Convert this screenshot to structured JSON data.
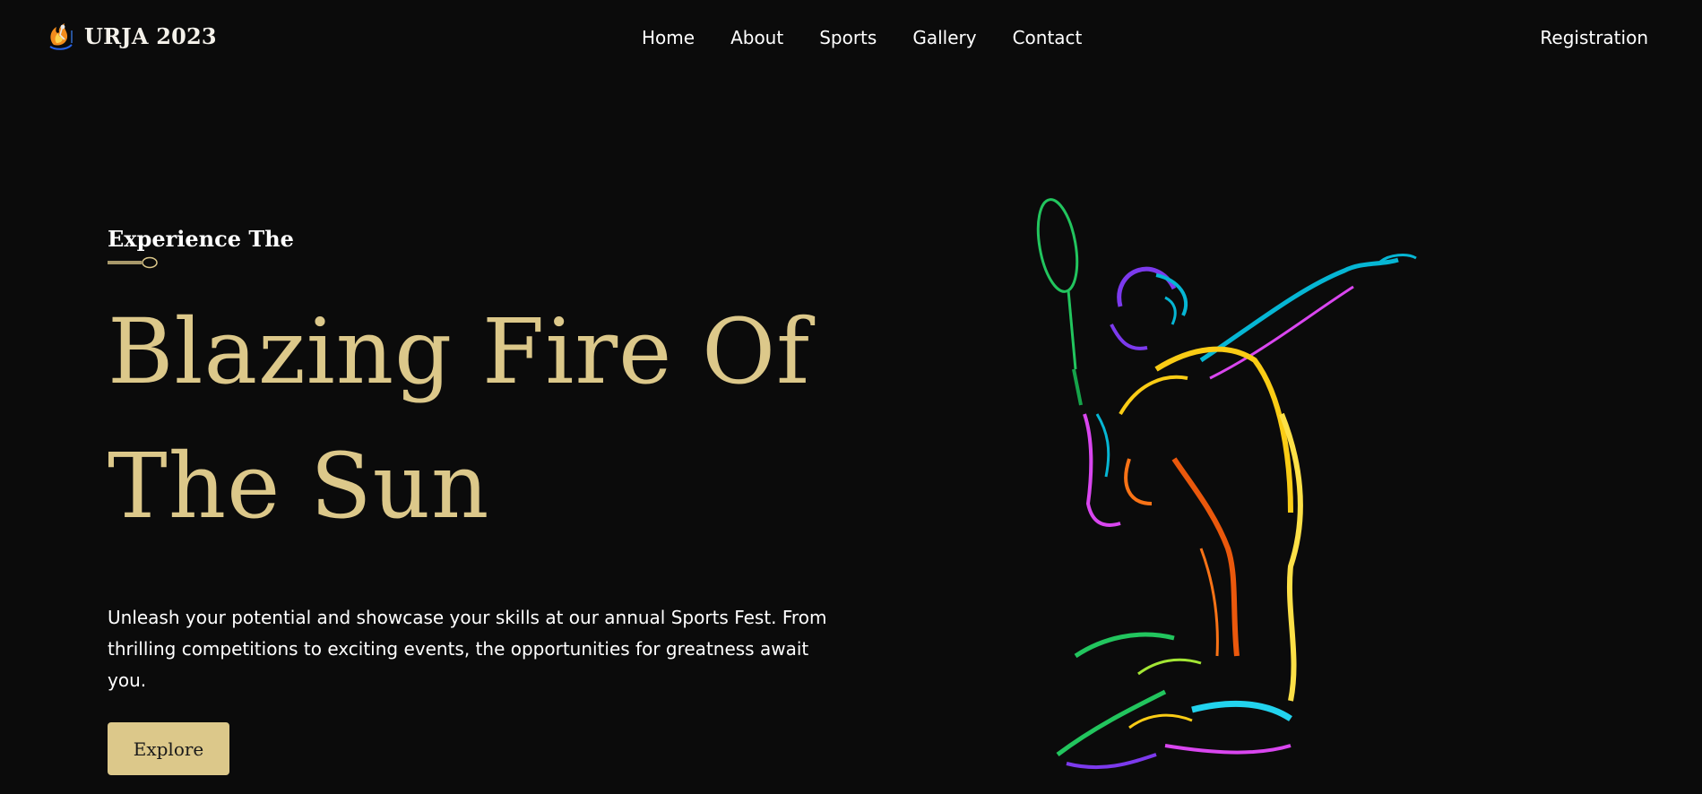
{
  "brand": {
    "name": "URJA 2023",
    "logo_icon": "flame-athlete-logo-icon"
  },
  "nav": {
    "links": [
      "Home",
      "About",
      "Sports",
      "Gallery",
      "Contact"
    ],
    "register": "Registration"
  },
  "hero": {
    "eyebrow": "Experience The",
    "headline_line1": "Blazing Fire Of",
    "headline_line2": "The Sun",
    "lead": "Unleash your potential and showcase your skills at our annual Sports Fest. From thrilling competitions to exciting events, the opportunities for greatness await you.",
    "cta": "Explore",
    "illustration_icon": "badminton-player-icon"
  },
  "colors": {
    "background": "#0b0b0b",
    "accent_gold": "#dcc88a",
    "text": "#ffffff"
  }
}
